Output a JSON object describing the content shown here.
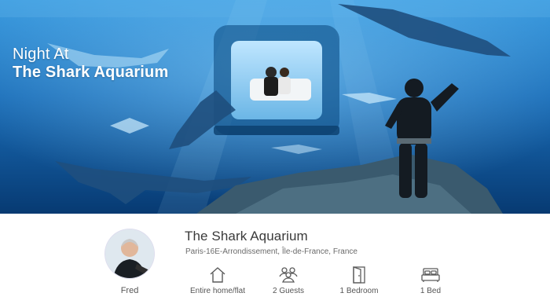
{
  "hero": {
    "title_line1": "Night At",
    "title_line2": "The Shark Aquarium"
  },
  "host": {
    "name": "Fred"
  },
  "listing": {
    "title": "The Shark Aquarium",
    "location": "Paris-16E-Arrondissement, Île-de-France, France"
  },
  "amenities": [
    {
      "icon": "house-icon",
      "label": "Entire home/flat"
    },
    {
      "icon": "guests-icon",
      "label": "2 Guests"
    },
    {
      "icon": "door-icon",
      "label": "1 Bedroom"
    },
    {
      "icon": "bed-icon",
      "label": "1 Bed"
    }
  ],
  "colors": {
    "water_light": "#2f8fd0",
    "water_dark": "#083a70",
    "text": "#484848"
  }
}
